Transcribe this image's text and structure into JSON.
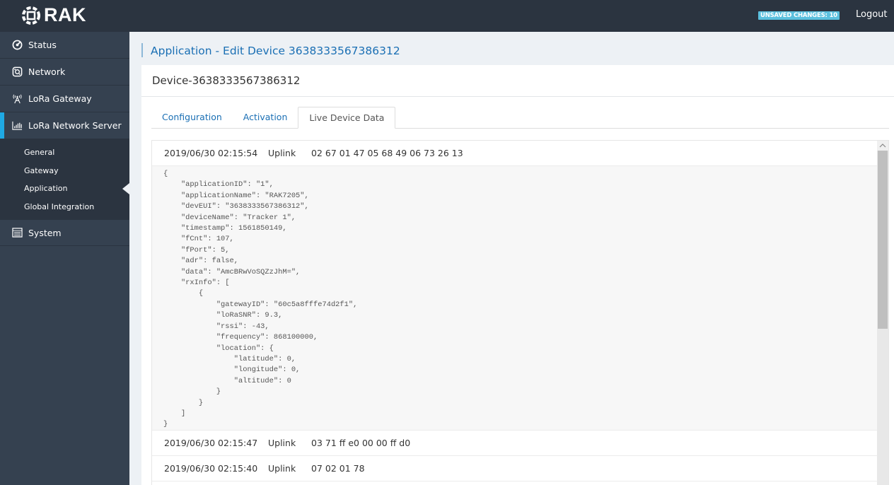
{
  "header": {
    "brand": "RAK",
    "unsaved_badge": "UNSAVED CHANGES: 10",
    "logout": "Logout",
    "colors": {
      "topbar": "#2b3440",
      "badge": "#5bc0de"
    }
  },
  "sidebar": {
    "items": [
      {
        "label": "Status",
        "icon": "gauge-icon"
      },
      {
        "label": "Network",
        "icon": "network-icon"
      },
      {
        "label": "LoRa Gateway",
        "icon": "antenna-icon"
      },
      {
        "label": "LoRa Network Server",
        "icon": "bar-chart-icon",
        "active": true
      }
    ],
    "subitems": [
      {
        "label": "General"
      },
      {
        "label": "Gateway"
      },
      {
        "label": "Application",
        "active": true
      },
      {
        "label": "Global Integration"
      }
    ],
    "system": {
      "label": "System",
      "icon": "list-icon"
    },
    "colors": {
      "active_accent": "#1fa9e4"
    }
  },
  "main": {
    "page_title": "Application - Edit Device 3638333567386312",
    "card_title": "Device-3638333567386312",
    "tabs": [
      {
        "label": "Configuration"
      },
      {
        "label": "Activation"
      },
      {
        "label": "Live Device Data",
        "active": true
      }
    ],
    "frames": [
      {
        "timestamp": "2019/06/30 02:15:54",
        "direction": "Uplink",
        "payload": "02 67 01 47 05 68 49 06 73 26 13",
        "expanded": true,
        "json": "{\n    \"applicationID\": \"1\",\n    \"applicationName\": \"RAK7205\",\n    \"devEUI\": \"3638333567386312\",\n    \"deviceName\": \"Tracker 1\",\n    \"timestamp\": 1561850149,\n    \"fCnt\": 107,\n    \"fPort\": 5,\n    \"adr\": false,\n    \"data\": \"AmcBRwVoSQZzJhM=\",\n    \"rxInfo\": [\n        {\n            \"gatewayID\": \"60c5a8fffe74d2f1\",\n            \"loRaSNR\": 9.3,\n            \"rssi\": -43,\n            \"frequency\": 868100000,\n            \"location\": {\n                \"latitude\": 0,\n                \"longitude\": 0,\n                \"altitude\": 0\n            }\n        }\n    ]\n}"
      },
      {
        "timestamp": "2019/06/30 02:15:47",
        "direction": "Uplink",
        "payload": "03 71 ff e0 00 00 ff d0"
      },
      {
        "timestamp": "2019/06/30 02:15:40",
        "direction": "Uplink",
        "payload": "07 02 01 78"
      }
    ]
  }
}
